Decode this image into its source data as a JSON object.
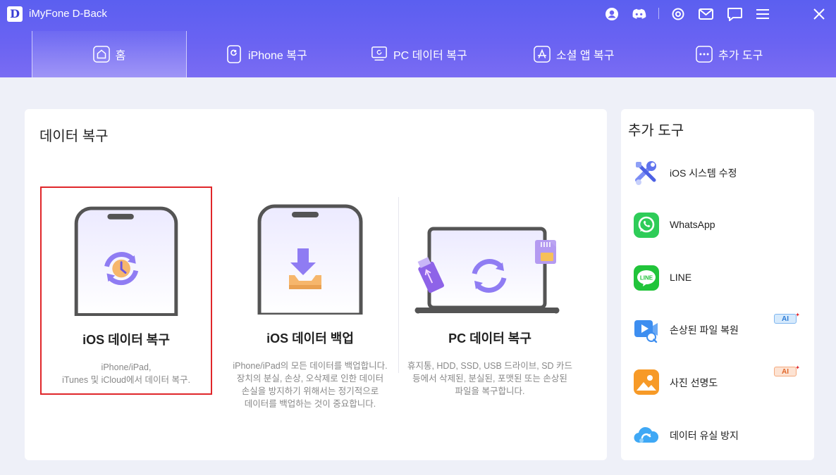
{
  "app": {
    "logo_letter": "D",
    "title": "iMyFone D-Back"
  },
  "titlebar_icons": [
    "account-icon",
    "discord-icon",
    "settings-icon",
    "mail-icon",
    "feedback-icon",
    "menu-icon",
    "close-icon"
  ],
  "nav": {
    "tabs": [
      {
        "label": "홈",
        "icon": "home-icon",
        "active": true
      },
      {
        "label": "iPhone 복구",
        "icon": "iphone-icon",
        "active": false
      },
      {
        "label": "PC 데이터 복구",
        "icon": "pc-icon",
        "active": false
      },
      {
        "label": "소셜 앱 복구",
        "icon": "apps-icon",
        "active": false
      },
      {
        "label": "추가 도구",
        "icon": "more-icon",
        "active": false
      }
    ]
  },
  "data_recovery": {
    "title": "데이터 복구",
    "options": [
      {
        "title": "iOS 데이터 복구",
        "desc_lines": [
          "iPhone/iPad,",
          "iTunes 및 iCloud에서 데이터 복구."
        ]
      },
      {
        "title": "iOS 데이터 백업",
        "desc_lines": [
          "iPhone/iPad의 모든 데이터를 백업합니다.",
          "장치의 분실, 손상, 오삭제로 인한 데이터",
          "손실을 방지하기 위해서는 정기적으로",
          "데이터를 백업하는 것이 중요합니다."
        ]
      },
      {
        "title": "PC 데이터 복구",
        "desc_lines": [
          "휴지통, HDD, SSD, USB 드라이브, SD 카드",
          "등에서 삭제된, 분실된, 포맷된 또는 손상된",
          "파일을 복구합니다."
        ]
      }
    ]
  },
  "extra_tools": {
    "title": "추가 도구",
    "items": [
      {
        "label": "iOS 시스템 수정",
        "icon": "tools-icon",
        "badge": null
      },
      {
        "label": "WhatsApp",
        "icon": "whatsapp-icon",
        "badge": null
      },
      {
        "label": "LINE",
        "icon": "line-icon",
        "badge": null
      },
      {
        "label": "손상된 파일 복원",
        "icon": "video-repair-icon",
        "badge": "AI"
      },
      {
        "label": "사진 선명도",
        "icon": "photo-enhance-icon",
        "badge": "AI"
      },
      {
        "label": "데이터 유실 방지",
        "icon": "cloud-icon",
        "badge": null
      }
    ]
  },
  "colors": {
    "header": "#5b5ff0",
    "accent": "#7b6cf5",
    "selected_border": "#e0262a",
    "background": "#eef0f8"
  }
}
